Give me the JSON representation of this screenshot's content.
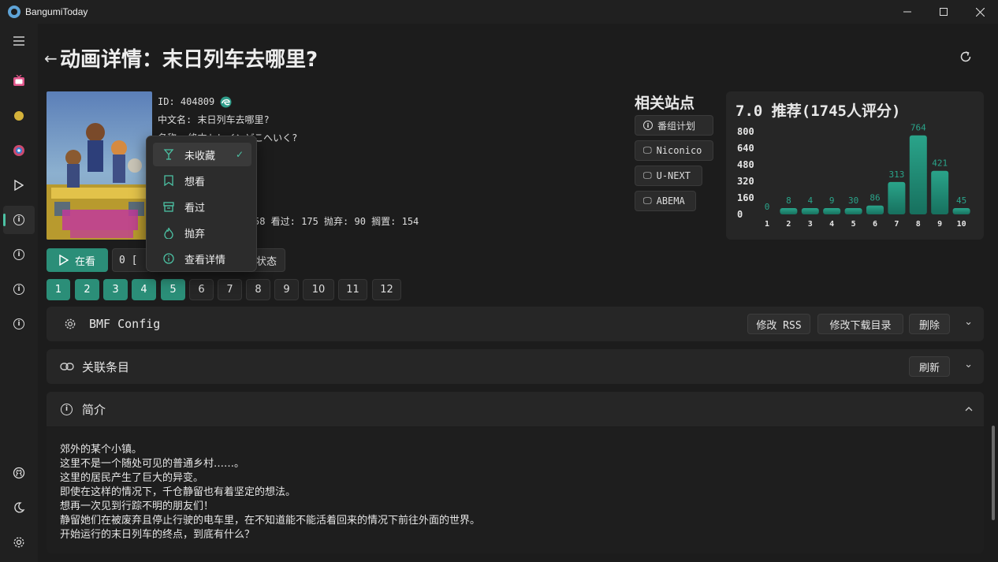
{
  "window": {
    "title": "BangumiToday"
  },
  "page": {
    "title": "动画详情：末日列车去哪里?"
  },
  "subject": {
    "id_line": "ID: 404809",
    "cn_name_line": "中文名: 末日列车去哪里?",
    "name_line": "名称: 終末トレインどこへいく?",
    "stats_line": "58 看过: 175 抛弃: 90 搁置: 154"
  },
  "related": {
    "title": "相关站点",
    "sites": [
      "番组计划",
      "Niconico",
      "U-NEXT",
      "ABEMA"
    ]
  },
  "chart_data": {
    "type": "bar",
    "title": "7.0 推荐(1745人评分)",
    "categories": [
      "1",
      "2",
      "3",
      "4",
      "5",
      "6",
      "7",
      "8",
      "9",
      "10"
    ],
    "values": [
      0,
      8,
      4,
      9,
      30,
      86,
      313,
      764,
      421,
      45
    ],
    "yticks": [
      "800",
      "640",
      "480",
      "320",
      "160",
      "0"
    ],
    "ylim": [
      0,
      800
    ],
    "bar_color": "#1f8f78"
  },
  "watch": {
    "button_label": "在看",
    "episode_value": "0  [",
    "status_button_label": "状态"
  },
  "episodes": {
    "watched": [
      "1",
      "2",
      "3",
      "4",
      "5"
    ],
    "unwatched": [
      "6",
      "7",
      "8",
      "9",
      "10",
      "11",
      "12"
    ]
  },
  "bmf": {
    "title": "BMF Config",
    "buttons": [
      "修改 RSS",
      "修改下载目录",
      "删除"
    ]
  },
  "relations": {
    "title": "关联条目",
    "refresh_label": "刷新"
  },
  "intro": {
    "title": "简介",
    "lines": [
      "郊外的某个小镇。",
      "这里不是一个随处可见的普通乡村……。",
      "这里的居民产生了巨大的异变。",
      "即使在这样的情况下，千仓静留也有着坚定的想法。",
      "想再一次见到行踪不明的朋友们！",
      "静留她们在被废弃且停止行驶的电车里，在不知道能不能活着回来的情况下前往外面的世界。",
      "开始运行的末日列车的终点，到底有什么？"
    ]
  },
  "menu": {
    "items": [
      "未收藏",
      "想看",
      "看过",
      "抛弃",
      "查看详情"
    ],
    "selected": "未收藏"
  },
  "colors": {
    "accent": "#2b8e78",
    "accent_light": "#4cc2a4"
  }
}
